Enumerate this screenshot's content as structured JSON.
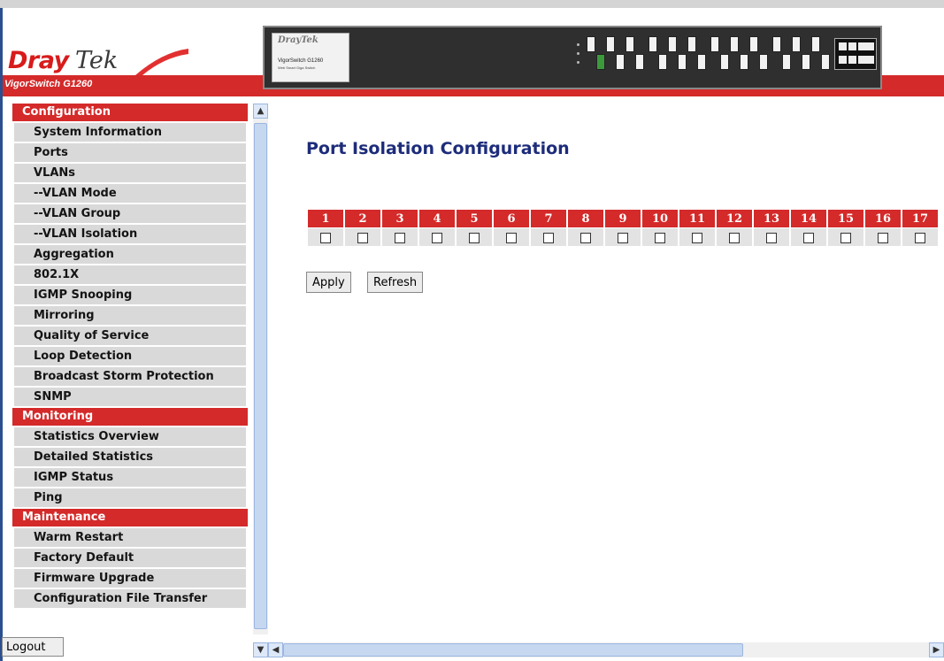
{
  "branding": {
    "logo_part1": "Dray",
    "logo_part2": "Tek",
    "model": "VigorSwitch G1260",
    "device_brand": "DrayTek",
    "device_model": "VigorSwitch G1260",
    "device_sub": "Web Smart Giga Switch"
  },
  "sidebar": {
    "sections": [
      {
        "title": "Configuration",
        "items": [
          "System Information",
          "Ports",
          "VLANs",
          "--VLAN Mode",
          "--VLAN Group",
          "--VLAN Isolation",
          "Aggregation",
          "802.1X",
          "IGMP Snooping",
          "Mirroring",
          "Quality of Service",
          "Loop Detection",
          "Broadcast Storm Protection",
          "SNMP"
        ]
      },
      {
        "title": "Monitoring",
        "items": [
          "Statistics Overview",
          "Detailed Statistics",
          "IGMP Status",
          "Ping"
        ]
      },
      {
        "title": "Maintenance",
        "items": [
          "Warm Restart",
          "Factory Default",
          "Firmware Upgrade",
          "Configuration File Transfer"
        ]
      }
    ],
    "logout_label": "Logout"
  },
  "main": {
    "title": "Port Isolation Configuration",
    "ports": [
      "1",
      "2",
      "3",
      "4",
      "5",
      "6",
      "7",
      "8",
      "9",
      "10",
      "11",
      "12",
      "13",
      "14",
      "15",
      "16",
      "17"
    ],
    "apply_label": "Apply",
    "refresh_label": "Refresh"
  },
  "colors": {
    "accent_red": "#d42a2a",
    "title_blue": "#1d2c7a",
    "menu_gray": "#d9d9d9"
  }
}
